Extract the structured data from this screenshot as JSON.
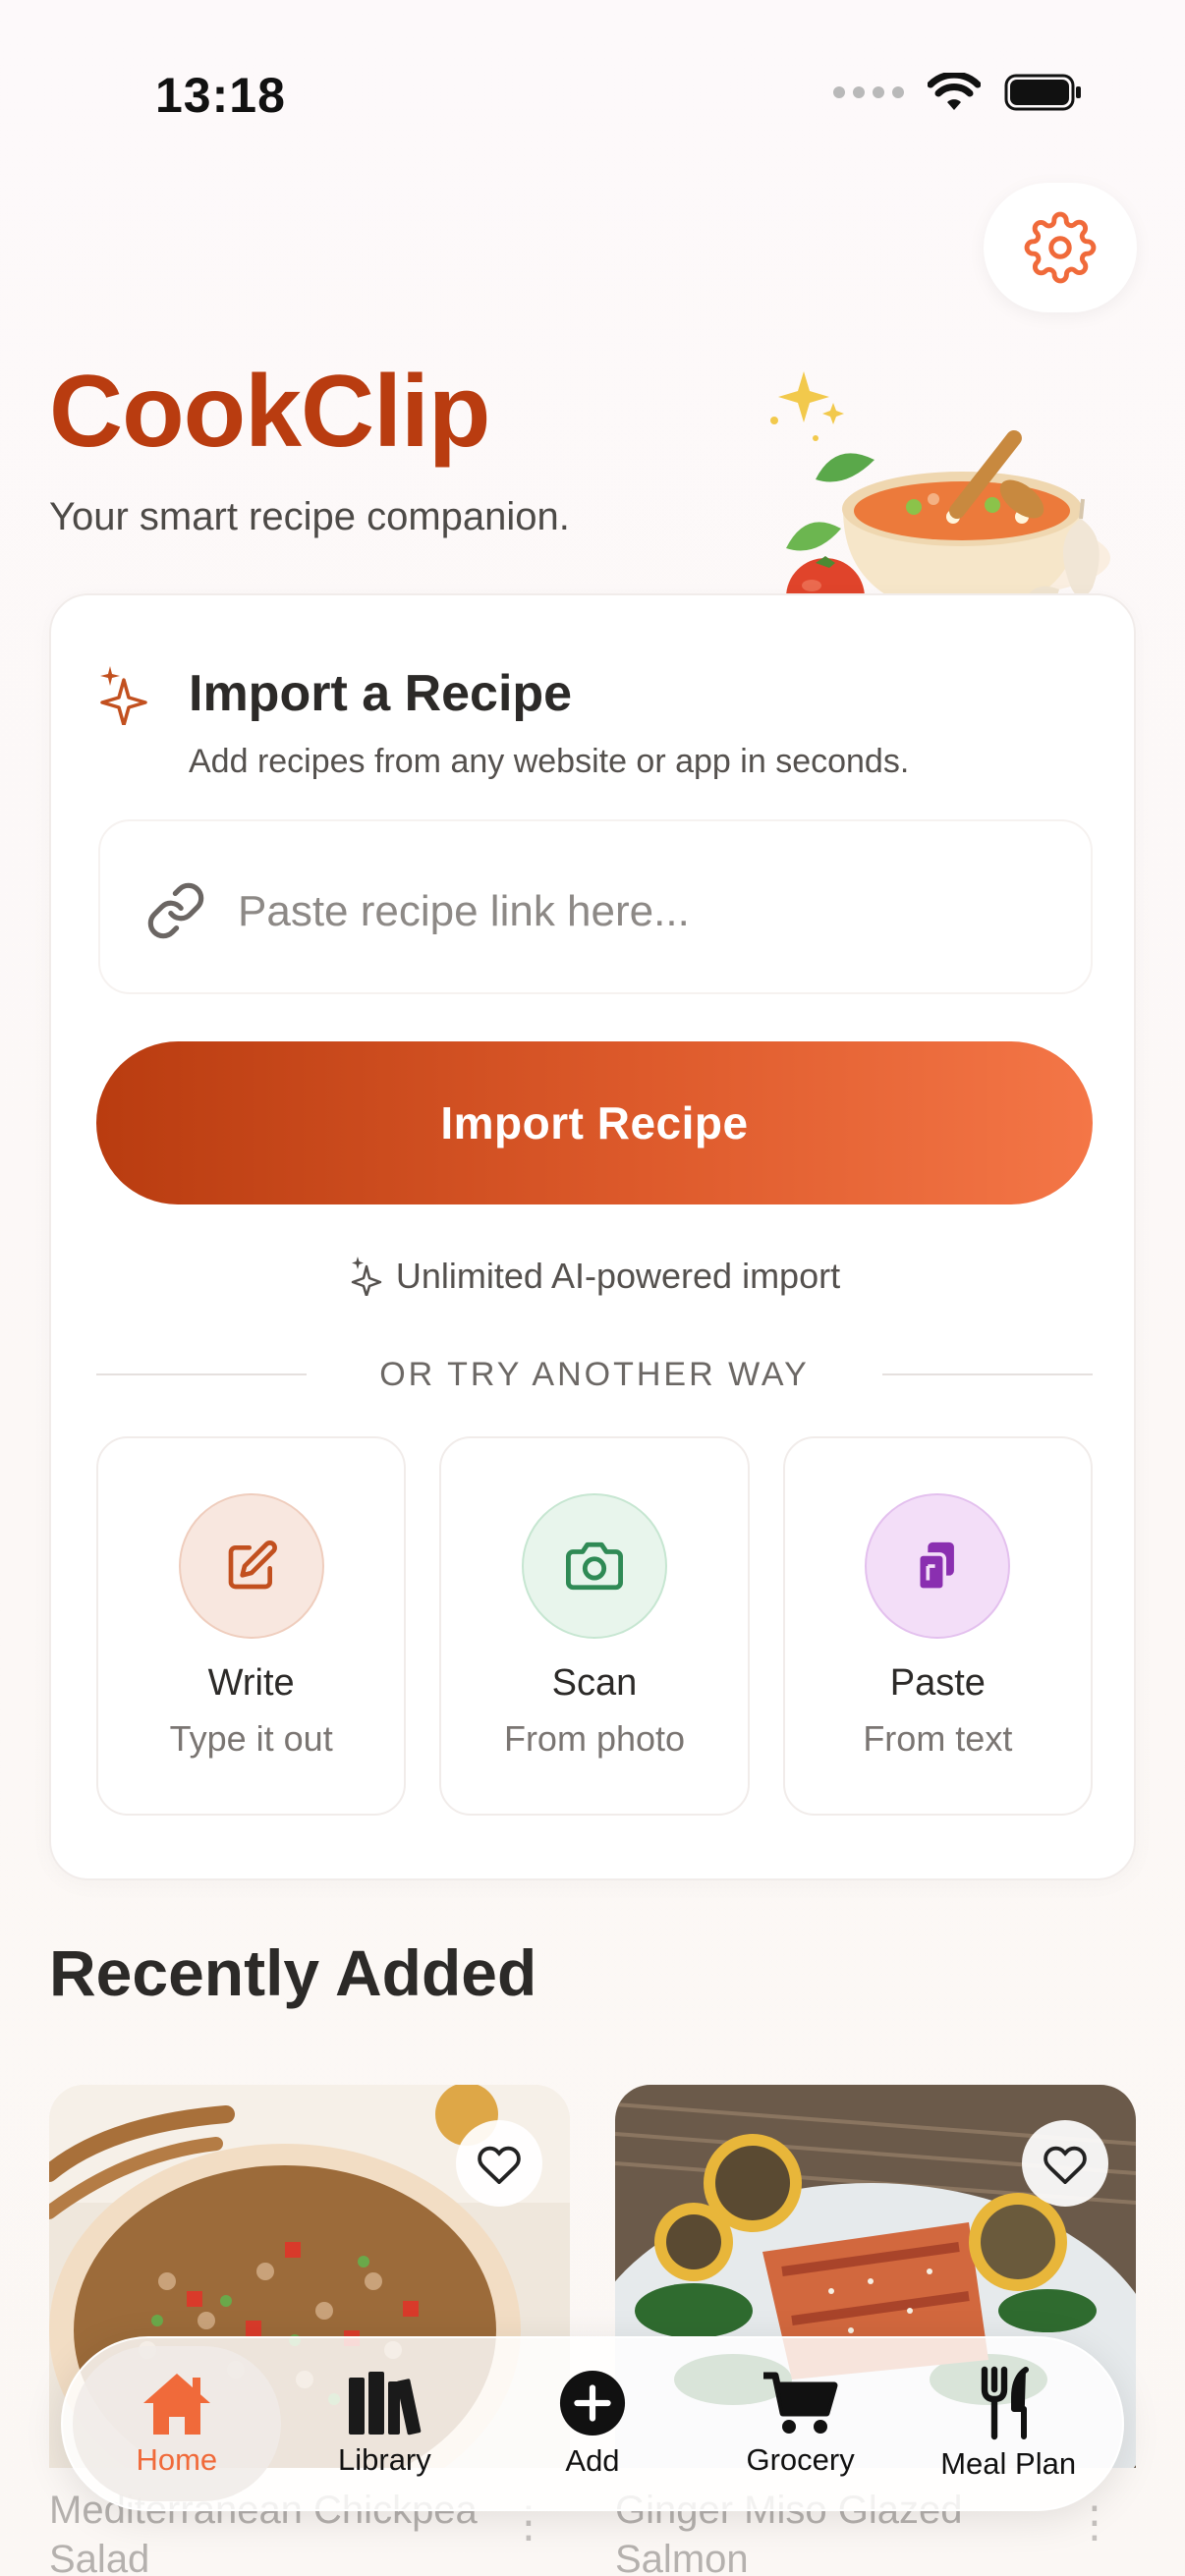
{
  "status_bar": {
    "time": "13:18"
  },
  "header": {
    "title": "CookClip",
    "tagline": "Your smart recipe companion."
  },
  "import_card": {
    "title": "Import a Recipe",
    "subtitle": "Add recipes from any website or app in seconds.",
    "input_placeholder": "Paste recipe link here...",
    "input_value": "",
    "button_label": "Import Recipe",
    "ai_note": "Unlimited AI-powered import",
    "divider_text": "OR TRY ANOTHER WAY",
    "options": [
      {
        "label": "Write",
        "sub": "Type it out",
        "icon": "edit-icon",
        "color": "#c2501f"
      },
      {
        "label": "Scan",
        "sub": "From photo",
        "icon": "camera-icon",
        "color": "#2f8a55"
      },
      {
        "label": "Paste",
        "sub": "From text",
        "icon": "clipboard-icon",
        "color": "#8a2fb0"
      }
    ]
  },
  "recently_added": {
    "title": "Recently Added",
    "recipes": [
      {
        "title": "Mediterranean Chickpea Salad"
      },
      {
        "title": "Ginger Miso Glazed Salmon"
      }
    ]
  },
  "tab_bar": {
    "tabs": [
      {
        "label": "Home",
        "icon": "home-icon",
        "active": true
      },
      {
        "label": "Library",
        "icon": "books-icon",
        "active": false
      },
      {
        "label": "Add",
        "icon": "plus-circle-icon",
        "active": false
      },
      {
        "label": "Grocery",
        "icon": "cart-icon",
        "active": false
      },
      {
        "label": "Meal Plan",
        "icon": "fork-knife-icon",
        "active": false
      }
    ]
  },
  "colors": {
    "brand": "#b93c10",
    "accent": "#f06a3a",
    "write_bg": "#f8e7df",
    "scan_bg": "#e8f5ec",
    "paste_bg": "#f3def8"
  }
}
